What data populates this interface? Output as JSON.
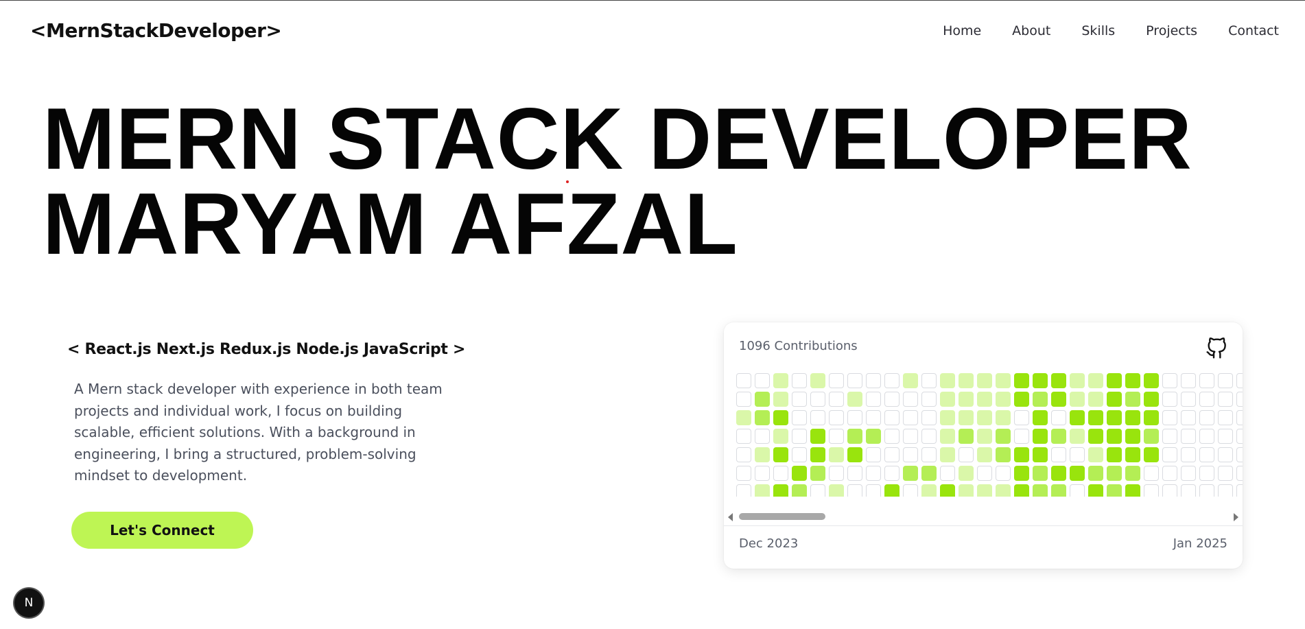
{
  "header": {
    "logo": "<MernStackDeveloper>",
    "nav": [
      "Home",
      "About",
      "Skills",
      "Projects",
      "Contact"
    ]
  },
  "hero": {
    "line1": "MERN STACK DEVELOPER",
    "line2": "MARYAM AFZAL"
  },
  "intro": {
    "tech_stack": "< React.js Next.js Redux.js Node.js JavaScript >",
    "bio": "A Mern stack developer with experience in both team projects and individual work, I focus on building scalable, efficient solutions. With a background in engineering, I bring a structured, problem-solving mindset to development.",
    "cta_label": "Let's Connect"
  },
  "contributions": {
    "total_label": "1096 Contributions",
    "icon": "github-icon",
    "start_label": "Dec 2023",
    "end_label": "Jan 2025",
    "level_colors": [
      "#ffffff",
      "#daf7a9",
      "#b4ee55",
      "#99e40d"
    ],
    "weeks": [
      [
        0,
        0,
        1,
        0,
        0,
        0,
        0
      ],
      [
        0,
        2,
        2,
        0,
        1,
        0,
        1
      ],
      [
        1,
        1,
        3,
        1,
        3,
        0,
        3
      ],
      [
        0,
        0,
        0,
        0,
        0,
        3,
        2
      ],
      [
        1,
        0,
        0,
        3,
        3,
        2,
        0
      ],
      [
        0,
        0,
        0,
        0,
        1,
        0,
        1
      ],
      [
        0,
        1,
        0,
        2,
        3,
        0,
        0
      ],
      [
        0,
        0,
        0,
        2,
        0,
        0,
        0
      ],
      [
        0,
        0,
        0,
        0,
        0,
        0,
        3
      ],
      [
        1,
        0,
        0,
        0,
        0,
        2,
        0
      ],
      [
        0,
        0,
        0,
        0,
        0,
        2,
        1
      ],
      [
        1,
        1,
        1,
        1,
        1,
        0,
        3
      ],
      [
        1,
        1,
        1,
        2,
        0,
        1,
        1
      ],
      [
        1,
        1,
        1,
        1,
        1,
        0,
        1
      ],
      [
        1,
        1,
        1,
        2,
        2,
        0,
        1
      ],
      [
        3,
        3,
        0,
        0,
        3,
        3,
        3
      ],
      [
        3,
        2,
        3,
        3,
        3,
        2,
        2
      ],
      [
        3,
        3,
        0,
        2,
        0,
        3,
        2
      ],
      [
        1,
        1,
        3,
        1,
        0,
        3,
        0
      ],
      [
        1,
        1,
        3,
        3,
        1,
        2,
        3
      ],
      [
        3,
        3,
        3,
        3,
        3,
        2,
        2
      ],
      [
        3,
        2,
        3,
        3,
        3,
        2,
        3
      ],
      [
        3,
        3,
        3,
        2,
        3,
        0,
        0
      ],
      [
        0,
        0,
        0,
        0,
        0,
        0,
        0
      ],
      [
        0,
        0,
        0,
        0,
        0,
        0,
        0
      ],
      [
        0,
        0,
        0,
        0,
        0,
        0,
        0
      ],
      [
        0,
        0,
        0,
        0,
        0,
        0,
        0
      ],
      [
        0,
        0,
        0,
        0,
        0,
        0,
        0
      ]
    ]
  },
  "badge": {
    "label": "N",
    "icon": "nextjs-icon"
  }
}
